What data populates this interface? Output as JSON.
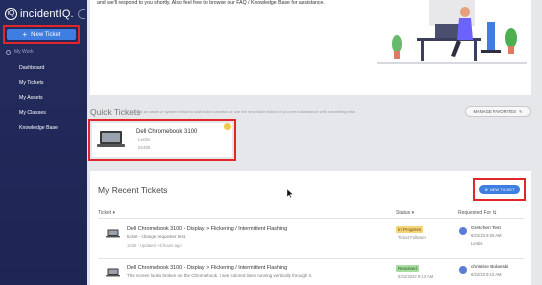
{
  "brand": {
    "name": "incidentIQ.",
    "logo_glyph": "iQ"
  },
  "sidebar": {
    "new_ticket_label": "New Ticket",
    "section_label": "My Work",
    "items": [
      {
        "label": "Dashboard"
      },
      {
        "label": "My Tickets"
      },
      {
        "label": "My Assets"
      },
      {
        "label": "My Classes"
      },
      {
        "label": "Knowledge Base"
      }
    ]
  },
  "banner": {
    "text": "and we'll respond to you shortly. Also feel free to browse our FAQ / Knowledge Base for assistance."
  },
  "quick_tickets": {
    "title": "Quick Tickets",
    "hint": "Click an asset or system below to start ticket creation or use the new ticket button if you need assistance with something else.",
    "manage_label": "MANAGE FAVORITES",
    "favorite": {
      "name": "Dell Chromebook 3100",
      "line1": "Lenbs",
      "line2": "52486"
    }
  },
  "recent": {
    "title": "My Recent Tickets",
    "new_ticket_label": "NEW TICKET",
    "columns": {
      "ticket": "Ticket",
      "status": "Status",
      "requested_for": "Requested For"
    },
    "rows": [
      {
        "title": "Dell Chromebook 3100 - Display > Flickering / Intermittent Flashing",
        "subtitle": "ticket - change requester test.",
        "meta": "1045 · Updated ~5 hours ago",
        "status": "In Progress",
        "status_color": "#f5d37a",
        "status_sub": "Ticket Follower",
        "requester": "Gretchen Test",
        "date": "6/22/23 9:26 AM",
        "location": "Lenbs"
      },
      {
        "title": "Dell Chromebook 3100 - Display > Flickering / Intermittent Flashing",
        "subtitle": "The screen looks broken on the Chromebook. I see colored lines running vertically through it.",
        "meta": "",
        "status": "Resolved",
        "status_color": "#a8dca0",
        "status_sub": "6/22/2023 9:13 AM",
        "requester": "christine Bolanski",
        "date": "6/22/23 9:10 AM",
        "location": ""
      }
    ]
  },
  "colors": {
    "sidebar": "#232c5e",
    "accent": "#3d7ee0",
    "highlight": "#e0282a"
  }
}
